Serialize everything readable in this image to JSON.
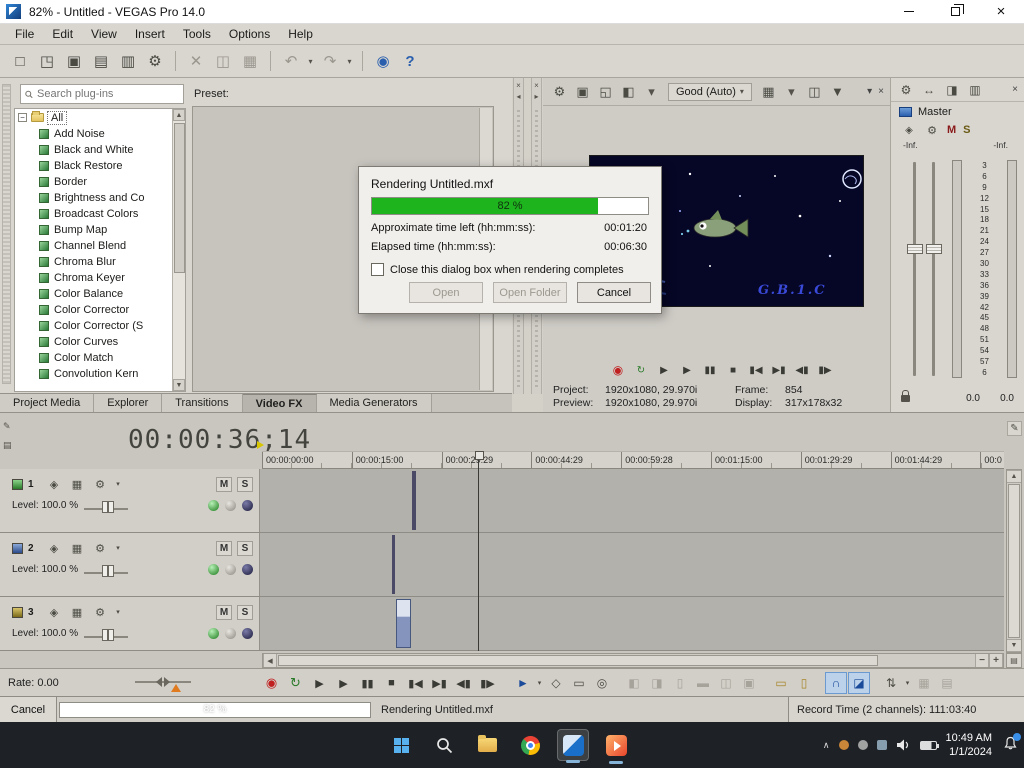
{
  "colors": {
    "progress_green": "#1eb41e",
    "selection_blue": "#2a5fae",
    "taskbar_bg": "#1e2125"
  },
  "titlebar": {
    "title": "82% - Untitled - VEGAS Pro 14.0"
  },
  "menubar": {
    "items": [
      "File",
      "Edit",
      "View",
      "Insert",
      "Tools",
      "Options",
      "Help"
    ]
  },
  "toolbar": {
    "items": [
      {
        "name": "new-project-icon",
        "glyph": "□"
      },
      {
        "name": "open-icon",
        "glyph": "◳"
      },
      {
        "name": "save-icon",
        "glyph": "▣"
      },
      {
        "name": "save-as-icon",
        "glyph": "▤"
      },
      {
        "name": "render-as-icon",
        "glyph": "▥"
      },
      {
        "name": "project-properties-icon",
        "glyph": "⚙"
      },
      {
        "name": "toolbar-separator",
        "glyph": "",
        "cls": "sep"
      },
      {
        "name": "cut-icon",
        "glyph": "✕",
        "cls": "dim"
      },
      {
        "name": "copy-icon",
        "glyph": "◫",
        "cls": "dim"
      },
      {
        "name": "paste-icon",
        "glyph": "▦",
        "cls": "dim"
      },
      {
        "name": "toolbar-separator",
        "glyph": "",
        "cls": "sep"
      },
      {
        "name": "undo-icon",
        "glyph": "↶",
        "cls": "dim"
      },
      {
        "name": "undo-dropdown-icon",
        "glyph": "▾",
        "cls": "dd"
      },
      {
        "name": "redo-icon",
        "glyph": "↷",
        "cls": "dim"
      },
      {
        "name": "redo-dropdown-icon",
        "glyph": "▾",
        "cls": "dd"
      },
      {
        "name": "toolbar-separator",
        "glyph": "",
        "cls": "sep"
      },
      {
        "name": "interactive-tutorials-icon",
        "glyph": "◉",
        "cls": "blue"
      },
      {
        "name": "whats-this-help-icon",
        "glyph": "?",
        "cls": "blue"
      }
    ]
  },
  "plugins_panel": {
    "search_placeholder": "Search plug-ins",
    "root_item": "All",
    "items": [
      "Add Noise",
      "Black and White",
      "Black Restore",
      "Border",
      "Brightness and Co",
      "Broadcast Colors",
      "Bump Map",
      "Channel Blend",
      "Chroma Blur",
      "Chroma Keyer",
      "Color Balance",
      "Color Corrector",
      "Color Corrector (S",
      "Color Curves",
      "Color Match",
      "Convolution Kern"
    ],
    "preset_label": "Preset:"
  },
  "dock_tabs": {
    "items": [
      {
        "label": "Project Media",
        "name": "tab-project-media"
      },
      {
        "label": "Explorer",
        "name": "tab-explorer"
      },
      {
        "label": "Transitions",
        "name": "tab-transitions"
      },
      {
        "label": "Video FX",
        "name": "tab-video-fx",
        "cls": "active"
      },
      {
        "label": "Media Generators",
        "name": "tab-media-generators"
      }
    ]
  },
  "preview": {
    "toolbar_left": [
      {
        "name": "preview-settings-gear-icon",
        "glyph": "⚙"
      },
      {
        "name": "project-video-properties-icon",
        "glyph": "▣"
      },
      {
        "name": "external-monitor-icon",
        "glyph": "◱"
      },
      {
        "name": "split-screen-view-icon",
        "glyph": "◧"
      },
      {
        "name": "split-screen-dropdown-icon",
        "glyph": "▾",
        "cls": "dd"
      }
    ],
    "quality_label": "Good (Auto)",
    "toolbar_right": [
      {
        "name": "overlays-grid-icon",
        "glyph": "▦"
      },
      {
        "name": "overlays-dropdown-icon",
        "glyph": "▾",
        "cls": "dd"
      },
      {
        "name": "copy-snapshot-icon",
        "glyph": "◫"
      },
      {
        "name": "save-snapshot-icon",
        "glyph": "▼"
      }
    ],
    "overlay_text": "G.B.1.C",
    "info_rows": [
      {
        "label": "Project:",
        "value": "1920x1080, 29.970i",
        "label2": "Frame:",
        "value2": "854"
      },
      {
        "label": "Preview:",
        "value": "1920x1080, 29.970i",
        "label2": "Display:",
        "value2": "317x178x32"
      }
    ]
  },
  "mixer": {
    "toolbar_icons": [
      {
        "name": "mixer-settings-gear-icon",
        "glyph": "⚙"
      },
      {
        "name": "insert-bus-icon",
        "glyph": "↔"
      },
      {
        "name": "mixer-view-icon",
        "glyph": "◨"
      },
      {
        "name": "mixer-meters-icon",
        "glyph": "▥"
      }
    ],
    "title": "Master",
    "mute_label": "M",
    "solo_label": "S",
    "inf_left": "-Inf.",
    "inf_right": "-Inf.",
    "scale": [
      "3",
      "6",
      "9",
      "12",
      "15",
      "18",
      "21",
      "24",
      "27",
      "30",
      "33",
      "36",
      "39",
      "42",
      "45",
      "48",
      "51",
      "54",
      "57",
      "6"
    ],
    "value_left": "0.0",
    "value_right": "0.0"
  },
  "timeline": {
    "timecode": "00:00:36;14",
    "ruler_labels": [
      "00:00:00:00",
      "00:00:15:00",
      "00:00:29:29",
      "00:00:44:29",
      "00:00:59:28",
      "00:01:15:00",
      "00:01:29:29",
      "00:01:44:29",
      "00:0"
    ],
    "tracks": [
      {
        "number": "1",
        "level_label": "Level: 100.0 %",
        "mute_label": "M",
        "solo_label": "S"
      },
      {
        "number": "2",
        "level_label": "Level: 100.0 %",
        "mute_label": "M",
        "solo_label": "S"
      },
      {
        "number": "3",
        "level_label": "Level: 100.0 %",
        "mute_label": "M",
        "solo_label": "S"
      }
    ]
  },
  "transport_buttons": [
    {
      "name": "record-button",
      "glyph": "◉",
      "cls": "rec"
    },
    {
      "name": "loop-playback-button",
      "glyph": "↻",
      "cls": "loop"
    },
    {
      "name": "play-from-start-button",
      "glyph": "▶"
    },
    {
      "name": "play-button",
      "glyph": "▶"
    },
    {
      "name": "pause-button",
      "glyph": "▮▮"
    },
    {
      "name": "stop-button",
      "glyph": "■"
    },
    {
      "name": "go-to-start-button",
      "glyph": "▮◀"
    },
    {
      "name": "go-to-end-button",
      "glyph": "▶▮"
    },
    {
      "name": "prev-frame-button",
      "glyph": "◀▮"
    },
    {
      "name": "next-frame-button",
      "glyph": "▮▶"
    }
  ],
  "transport": {
    "rate_label": "Rate: 0.00",
    "tools": [
      {
        "name": "normal-edit-tool-button",
        "glyph": "►",
        "cls": "blue"
      },
      {
        "name": "edit-tool-dropdown",
        "glyph": "▾",
        "cls": "dd"
      },
      {
        "name": "envelope-edit-tool-button",
        "glyph": "◇"
      },
      {
        "name": "selection-edit-tool-button",
        "glyph": "▭"
      },
      {
        "name": "zoom-edit-tool-button",
        "glyph": "◎"
      },
      {
        "name": "tool-separator",
        "glyph": "",
        "cls": "sep"
      },
      {
        "name": "trim-start-button",
        "glyph": "◧",
        "cls": "dim"
      },
      {
        "name": "trim-end-button",
        "glyph": "◨",
        "cls": "dim"
      },
      {
        "name": "split-button",
        "glyph": "▯",
        "cls": "dim"
      },
      {
        "name": "slip-button",
        "glyph": "▬",
        "cls": "dim"
      },
      {
        "name": "slide-button",
        "glyph": "◫",
        "cls": "dim"
      },
      {
        "name": "lock-event-button",
        "glyph": "▣",
        "cls": "dim"
      },
      {
        "name": "tool-separator",
        "glyph": "",
        "cls": "sep"
      },
      {
        "name": "insert-marker-button",
        "glyph": "▭",
        "cls": "yellow"
      },
      {
        "name": "insert-region-button",
        "glyph": "▯",
        "cls": "yellow"
      },
      {
        "name": "tool-separator",
        "glyph": "",
        "cls": "sep"
      },
      {
        "name": "enable-snapping-button",
        "glyph": "∩",
        "cls": "active"
      },
      {
        "name": "auto-ripple-button",
        "glyph": "◪",
        "cls": "active"
      },
      {
        "name": "tool-separator",
        "glyph": "",
        "cls": "sep"
      },
      {
        "name": "mixer-layout-button",
        "glyph": "⇅"
      },
      {
        "name": "layout-dropdown",
        "glyph": "▾",
        "cls": "dd"
      },
      {
        "name": "track-view-button",
        "glyph": "▦",
        "cls": "dim"
      },
      {
        "name": "detail-view-button",
        "glyph": "▤",
        "cls": "dim"
      }
    ]
  },
  "statusbar": {
    "cancel_label": "Cancel",
    "progress_value": 82,
    "progress_text": "82 %",
    "message": "Rendering Untitled.mxf",
    "record_time": "Record Time (2 channels): 111:03:40"
  },
  "render_dialog": {
    "title": "Rendering Untitled.mxf",
    "progress_value": 82,
    "progress_text": "82 %",
    "time_left_label": "Approximate time left (hh:mm:ss):",
    "time_left_value": "00:01:20",
    "elapsed_label": "Elapsed time (hh:mm:ss):",
    "elapsed_value": "00:06:30",
    "checkbox_label": "Close this dialog box when rendering completes",
    "open_label": "Open",
    "open_folder_label": "Open Folder",
    "cancel_label": "Cancel"
  },
  "taskbar": {
    "time": "10:49 AM",
    "date": "1/1/2024"
  },
  "icons": {
    "dropdown": "▾",
    "panel_close": "×",
    "collapse_left": "◂",
    "collapse_right": "▸",
    "pencil": "✎",
    "marker_tool": "▤",
    "expander_minus": "−",
    "scroll_up": "▲",
    "scroll_down": "▼",
    "scroll_left": "◀",
    "scroll_right": "▶",
    "zoom_in": "+",
    "zoom_out": "−",
    "chevron_up": "∧",
    "track_motion": "◈",
    "track_fx": "▦",
    "gear": "⚙",
    "pin": "▾"
  }
}
